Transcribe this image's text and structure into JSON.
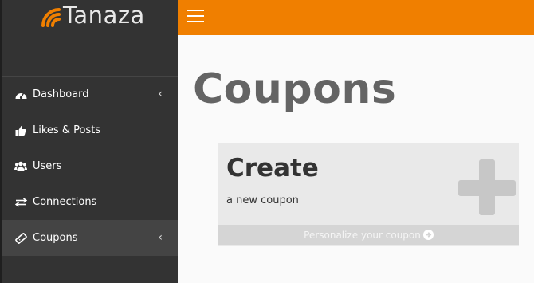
{
  "brand": {
    "name": "Tanaza",
    "logo_icon": "wifi-signal-icon",
    "accent": "#f07f00"
  },
  "topbar": {
    "menu_icon": "hamburger-icon",
    "color": "#f07f00"
  },
  "sidebar": {
    "items": [
      {
        "label": "Dashboard",
        "icon": "dashboard-icon",
        "chevron": "‹"
      },
      {
        "label": "Likes & Posts",
        "icon": "thumbs-up-icon"
      },
      {
        "label": "Users",
        "icon": "users-icon"
      },
      {
        "label": "Connections",
        "icon": "exchange-icon"
      },
      {
        "label": "Coupons",
        "icon": "ticket-icon",
        "chevron": "‹",
        "active": true
      }
    ]
  },
  "main": {
    "title": "Coupons",
    "card": {
      "title": "Create",
      "subtitle": "a new coupon",
      "plus_icon": "plus-icon",
      "footer_label": "Personalize your coupon",
      "footer_icon": "arrow-circle-right-icon"
    }
  }
}
